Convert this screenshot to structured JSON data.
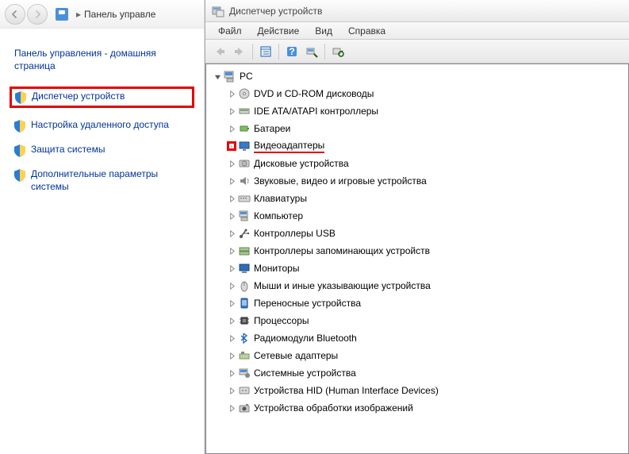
{
  "left": {
    "breadcrumb": "Панель управле",
    "home_title": "Панель управления - домашняя страница",
    "items": [
      {
        "label": "Диспетчер устройств",
        "highlight": true
      },
      {
        "label": "Настройка удаленного доступа"
      },
      {
        "label": "Защита системы"
      },
      {
        "label": "Дополнительные параметры системы"
      }
    ]
  },
  "dm": {
    "title": "Диспетчер устройств",
    "menu": {
      "file": "Файл",
      "action": "Действие",
      "view": "Вид",
      "help": "Справка"
    },
    "root": "PC",
    "categories": [
      {
        "label": "DVD и CD-ROM дисководы",
        "icon": "disc"
      },
      {
        "label": "IDE ATA/ATAPI контроллеры",
        "icon": "ide"
      },
      {
        "label": "Батареи",
        "icon": "battery"
      },
      {
        "label": "Видеоадаптеры",
        "icon": "display",
        "highlight": true
      },
      {
        "label": "Дисковые устройства",
        "icon": "hdd"
      },
      {
        "label": "Звуковые, видео и игровые устройства",
        "icon": "sound"
      },
      {
        "label": "Клавиатуры",
        "icon": "keyboard"
      },
      {
        "label": "Компьютер",
        "icon": "computer"
      },
      {
        "label": "Контроллеры USB",
        "icon": "usb"
      },
      {
        "label": "Контроллеры запоминающих устройств",
        "icon": "storage"
      },
      {
        "label": "Мониторы",
        "icon": "monitor"
      },
      {
        "label": "Мыши и иные указывающие устройства",
        "icon": "mouse"
      },
      {
        "label": "Переносные устройства",
        "icon": "portable"
      },
      {
        "label": "Процессоры",
        "icon": "cpu"
      },
      {
        "label": "Радиомодули Bluetooth",
        "icon": "bluetooth"
      },
      {
        "label": "Сетевые адаптеры",
        "icon": "network"
      },
      {
        "label": "Системные устройства",
        "icon": "system"
      },
      {
        "label": "Устройства HID (Human Interface Devices)",
        "icon": "hid"
      },
      {
        "label": "Устройства обработки изображений",
        "icon": "imaging"
      }
    ]
  }
}
